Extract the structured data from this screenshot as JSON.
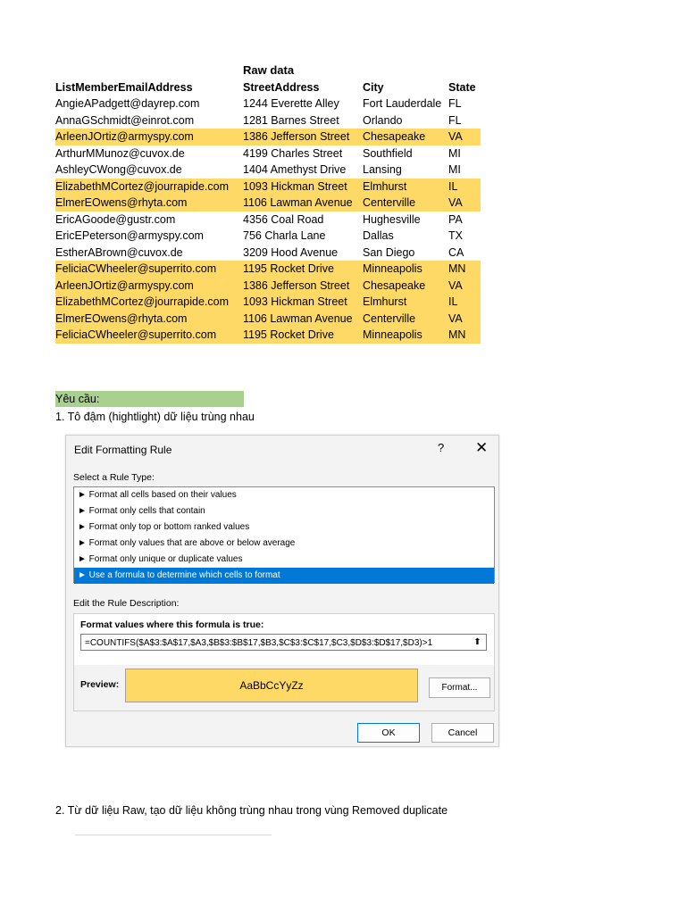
{
  "sheet": {
    "caption": "Raw data",
    "headers": [
      "ListMemberEmailAddress",
      "StreetAddress",
      "City",
      "State"
    ],
    "rows": [
      {
        "email": "AngieAPadgett@dayrep.com",
        "street": "1244 Everette Alley",
        "city": "Fort Lauderdale",
        "state": "FL",
        "highlight": false
      },
      {
        "email": "AnnaGSchmidt@einrot.com",
        "street": "1281 Barnes Street",
        "city": "Orlando",
        "state": "FL",
        "highlight": false
      },
      {
        "email": "ArleenJOrtiz@armyspy.com",
        "street": "1386 Jefferson Street",
        "city": "Chesapeake",
        "state": "VA",
        "highlight": true
      },
      {
        "email": "ArthurMMunoz@cuvox.de",
        "street": "4199 Charles Street",
        "city": "Southfield",
        "state": "MI",
        "highlight": false
      },
      {
        "email": "AshleyCWong@cuvox.de",
        "street": "1404 Amethyst Drive",
        "city": "Lansing",
        "state": "MI",
        "highlight": false
      },
      {
        "email": "ElizabethMCortez@jourrapide.com",
        "street": "1093 Hickman Street",
        "city": "Elmhurst",
        "state": "IL",
        "highlight": true
      },
      {
        "email": "ElmerEOwens@rhyta.com",
        "street": "1106 Lawman Avenue",
        "city": "Centerville",
        "state": "VA",
        "highlight": true
      },
      {
        "email": "EricAGoode@gustr.com",
        "street": "4356 Coal Road",
        "city": "Hughesville",
        "state": "PA",
        "highlight": false
      },
      {
        "email": "EricEPeterson@armyspy.com",
        "street": "756 Charla Lane",
        "city": "Dallas",
        "state": "TX",
        "highlight": false
      },
      {
        "email": "EstherABrown@cuvox.de",
        "street": "3209 Hood Avenue",
        "city": "San Diego",
        "state": "CA",
        "highlight": false
      },
      {
        "email": "FeliciaCWheeler@superrito.com",
        "street": "1195 Rocket Drive",
        "city": "Minneapolis",
        "state": "MN",
        "highlight": true
      },
      {
        "email": "ArleenJOrtiz@armyspy.com",
        "street": "1386 Jefferson Street",
        "city": "Chesapeake",
        "state": "VA",
        "highlight": true
      },
      {
        "email": "ElizabethMCortez@jourrapide.com",
        "street": "1093 Hickman Street",
        "city": "Elmhurst",
        "state": "IL",
        "highlight": true
      },
      {
        "email": "ElmerEOwens@rhyta.com",
        "street": "1106 Lawman Avenue",
        "city": "Centerville",
        "state": "VA",
        "highlight": true
      },
      {
        "email": "FeliciaCWheeler@superrito.com",
        "street": "1195 Rocket Drive",
        "city": "Minneapolis",
        "state": "MN",
        "highlight": true
      }
    ]
  },
  "requirements": {
    "label": "Yêu cầu:",
    "item1": "1. Tô đậm (hightlight) dữ liệu trùng nhau",
    "item2": "2. Từ dữ liệu Raw, tạo dữ liệu không trùng nhau trong vùng Removed duplicate"
  },
  "dialog": {
    "title": "Edit Formatting Rule",
    "help": "?",
    "close": "✕",
    "select_rule_label": "Select a Rule Type:",
    "rule_types": [
      "► Format all cells based on their values",
      "► Format only cells that contain",
      "► Format only top or bottom ranked values",
      "► Format only values that are above or below average",
      "► Format only unique or duplicate values",
      "► Use a formula to determine which cells to format"
    ],
    "selected_rule": 5,
    "edit_desc_label": "Edit the Rule Description:",
    "formula_label": "Format values where this formula is true:",
    "formula": "=COUNTIFS($A$3:$A$17,$A3,$B$3:$B$17,$B3,$C$3:$C$17,$C3,$D$3:$D$17,$D3)>1",
    "collapse_icon": "⬆",
    "preview_label": "Preview:",
    "preview_text": "AaBbCcYyZz",
    "format_button": "Format...",
    "ok_button": "OK",
    "cancel_button": "Cancel"
  },
  "colors": {
    "highlight": "#ffd966",
    "requirement_label_bg": "#a9d08e",
    "selection": "#0078d7"
  }
}
